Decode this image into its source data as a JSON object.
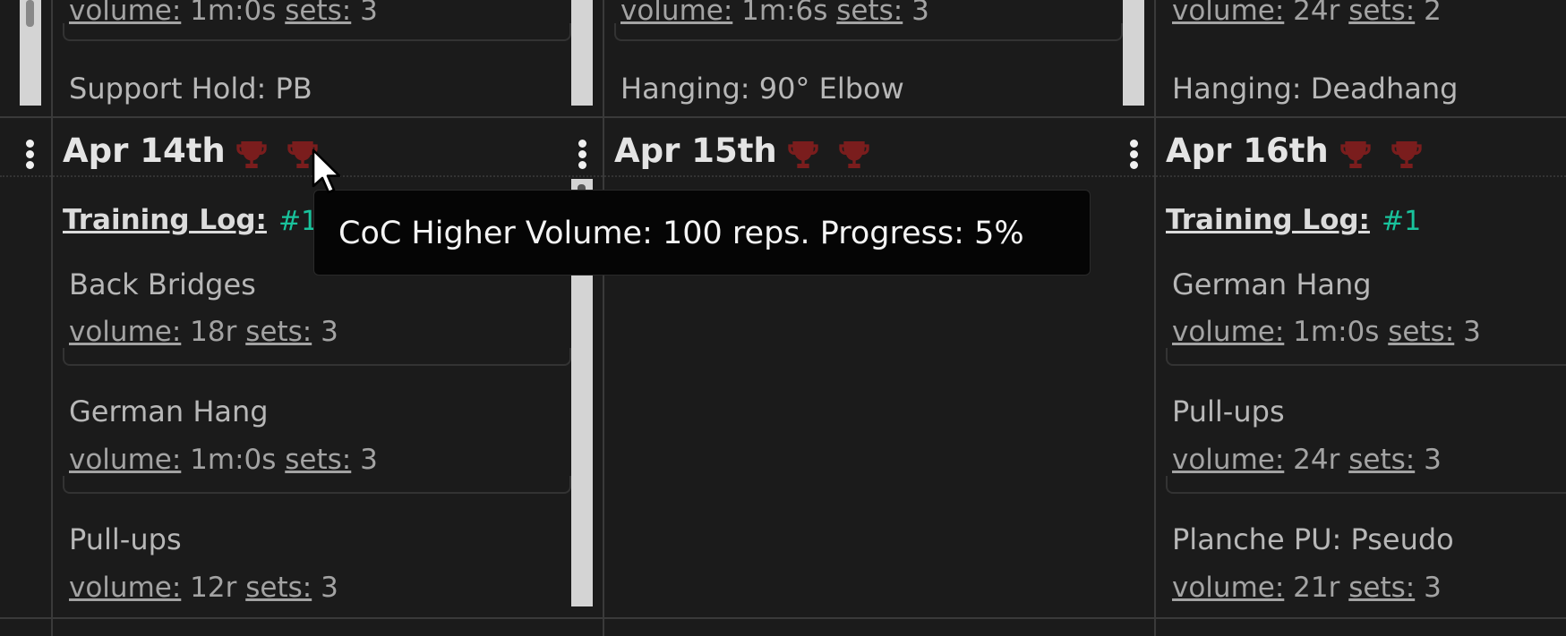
{
  "top_row": {
    "col1": {
      "meta": {
        "volume_label": "volume:",
        "volume_value": "1m:0s",
        "sets_label": "sets:",
        "sets_value": "3"
      },
      "next_exercise": "Support Hold: PB"
    },
    "col2": {
      "meta": {
        "volume_label": "volume:",
        "volume_value": "1m:6s",
        "sets_label": "sets:",
        "sets_value": "3"
      },
      "next_exercise": "Hanging: 90° Elbow"
    },
    "col3": {
      "meta": {
        "volume_label": "volume:",
        "volume_value": "24r",
        "sets_label": "sets:",
        "sets_value": "2"
      },
      "next_exercise": "Hanging: Deadhang"
    }
  },
  "days": [
    {
      "date": "Apr 14th",
      "log_label": "Training Log:",
      "log_number": "#1",
      "exercises": [
        {
          "name": "Back Bridges",
          "volume_label": "volume:",
          "volume": "18r",
          "sets_label": "sets:",
          "sets": "3"
        },
        {
          "name": "German Hang",
          "volume_label": "volume:",
          "volume": "1m:0s",
          "sets_label": "sets:",
          "sets": "3"
        },
        {
          "name": "Pull-ups",
          "volume_label": "volume:",
          "volume": "12r",
          "sets_label": "sets:",
          "sets": "3"
        }
      ]
    },
    {
      "date": "Apr 15th"
    },
    {
      "date": "Apr 16th",
      "log_label": "Training Log:",
      "log_number": "#1",
      "exercises": [
        {
          "name": "German Hang",
          "volume_label": "volume:",
          "volume": "1m:0s",
          "sets_label": "sets:",
          "sets": "3"
        },
        {
          "name": "Pull-ups",
          "volume_label": "volume:",
          "volume": "24r",
          "sets_label": "sets:",
          "sets": "3"
        },
        {
          "name": "Planche PU: Pseudo",
          "volume_label": "volume:",
          "volume": "21r",
          "sets_label": "sets:",
          "sets": "3"
        }
      ]
    }
  ],
  "tooltip": {
    "text": "CoC Higher Volume: 100 reps. Progress: 5%"
  },
  "colors": {
    "background": "#1b1b1b",
    "trophy": "#7a1d1d",
    "log_number": "#19c39c",
    "tooltip_bg": "#050505"
  },
  "icons": [
    "trophy-icon",
    "kebab-menu-icon",
    "mouse-cursor-icon"
  ]
}
